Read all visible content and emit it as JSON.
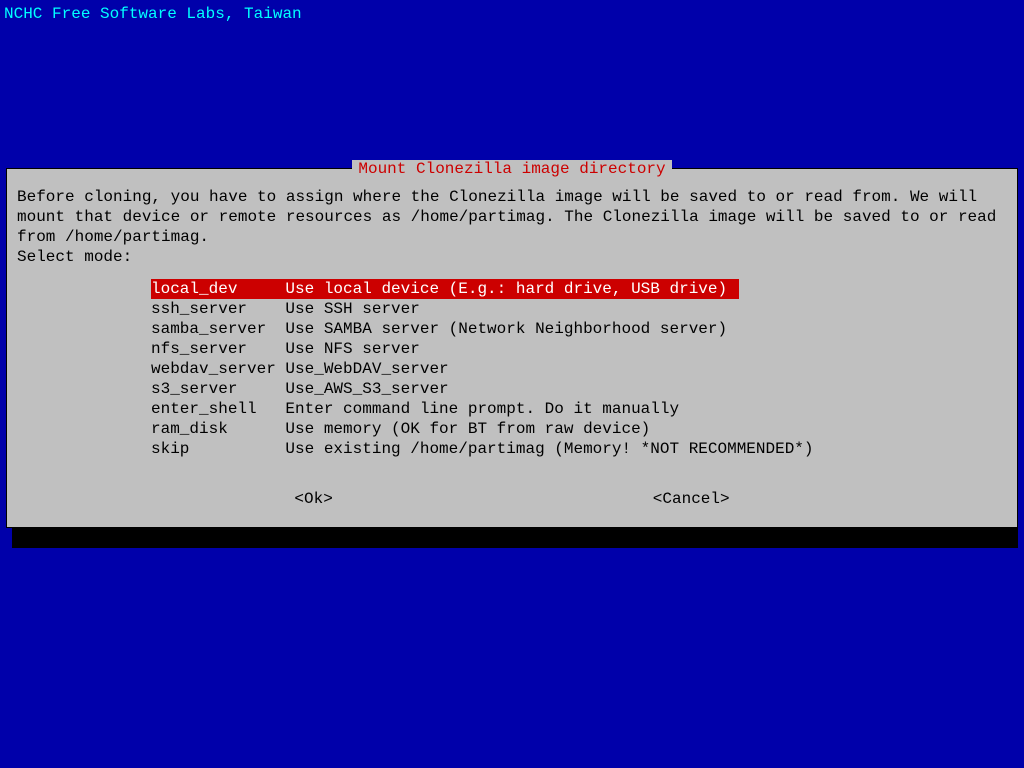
{
  "header": "NCHC Free Software Labs, Taiwan",
  "dialog": {
    "title": "Mount Clonezilla image directory",
    "instructions": "Before cloning, you have to assign where the Clonezilla image will be saved to or read from. We will mount that device or remote resources as /home/partimag. The Clonezilla image will be saved to or read from /home/partimag.\nSelect mode:",
    "menu": [
      {
        "key": "local_dev",
        "desc": "Use local device (E.g.: hard drive, USB drive)",
        "selected": true
      },
      {
        "key": "ssh_server",
        "desc": "Use SSH server",
        "selected": false
      },
      {
        "key": "samba_server",
        "desc": "Use SAMBA server (Network Neighborhood server)",
        "selected": false
      },
      {
        "key": "nfs_server",
        "desc": "Use NFS server",
        "selected": false
      },
      {
        "key": "webdav_server",
        "desc": "Use_WebDAV_server",
        "selected": false
      },
      {
        "key": "s3_server",
        "desc": "Use_AWS_S3_server",
        "selected": false
      },
      {
        "key": "enter_shell",
        "desc": "Enter command line prompt. Do it manually",
        "selected": false
      },
      {
        "key": "ram_disk",
        "desc": "Use memory (OK for BT from raw device)",
        "selected": false
      },
      {
        "key": "skip",
        "desc": "Use existing /home/partimag (Memory! *NOT RECOMMENDED*)",
        "selected": false
      }
    ],
    "ok_label": "<Ok>",
    "cancel_label": "<Cancel>"
  },
  "colors": {
    "background": "#0000aa",
    "panel": "#c0c0c0",
    "highlight": "#cc0000",
    "cyan": "#00ffff"
  }
}
